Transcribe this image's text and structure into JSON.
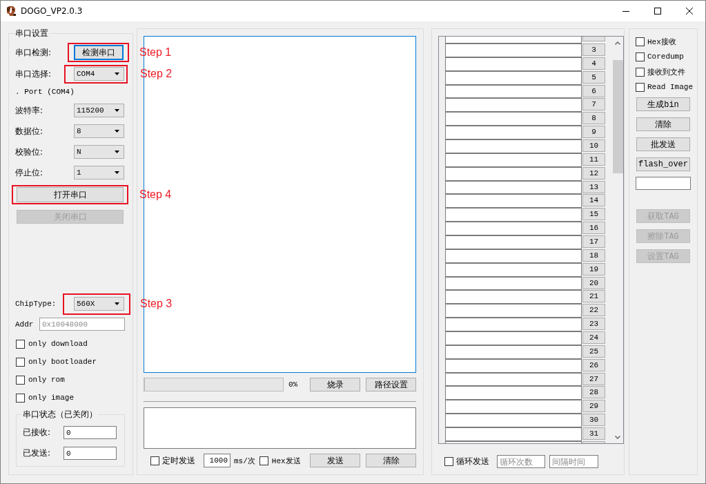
{
  "window": {
    "title": "DOGO_VP2.0.3"
  },
  "serial_settings": {
    "title": "串口设置",
    "fields": [
      {
        "kind": "button",
        "label": "串口检测:",
        "value": "检测串口",
        "focused": true,
        "annotation": "Step 1"
      },
      {
        "kind": "select",
        "label": "串口选择:",
        "value": "COM4",
        "annotation": "Step 2"
      },
      {
        "kind": "text",
        "label": ". Port (COM4)"
      },
      {
        "kind": "select",
        "label": "波特率:",
        "value": "115200"
      },
      {
        "kind": "select",
        "label": "数据位:",
        "value": "8"
      },
      {
        "kind": "select",
        "label": "校验位:",
        "value": "N"
      },
      {
        "kind": "select",
        "label": "停止位:",
        "value": "1"
      }
    ],
    "open_button": {
      "label": "打开串口",
      "disabled": false,
      "annotation": "Step 4"
    },
    "close_button": {
      "label": "关闭串口",
      "disabled": true
    },
    "chip_type": {
      "label": "ChipType:",
      "value": "560X",
      "annotation": "Step 3"
    },
    "addr": {
      "label": "Addr",
      "placeholder": "0x10048000"
    },
    "options": [
      {
        "label": "only download",
        "checked": false
      },
      {
        "label": "only bootloader",
        "checked": false
      },
      {
        "label": "only rom",
        "checked": false
      },
      {
        "label": "only image",
        "checked": false
      }
    ],
    "port_status": {
      "title": "串口状态（已关闭）",
      "counters": [
        {
          "label": "已接收:",
          "value": "0"
        },
        {
          "label": "已发送:",
          "value": "0"
        }
      ]
    }
  },
  "data_panel": {
    "receive_area": {
      "focused": true
    },
    "progress": {
      "level": 0,
      "reading": "0%"
    },
    "flash_buttons": [
      "烧录",
      "路径设置"
    ],
    "timed_send": {
      "label": "定时发送",
      "checked": false
    },
    "interval": {
      "value": "1000",
      "unit": "ms/次"
    },
    "hex_send": {
      "label": "Hex发送",
      "checked": false
    },
    "send_buttons": [
      "发送",
      "清除"
    ]
  },
  "send_list": {
    "rows": [
      {
        "number": "3"
      },
      {
        "number": "4"
      },
      {
        "number": "5"
      },
      {
        "number": "6"
      },
      {
        "number": "7"
      },
      {
        "number": "8"
      },
      {
        "number": "9"
      },
      {
        "number": "10"
      },
      {
        "number": "11"
      },
      {
        "number": "12"
      },
      {
        "number": "13"
      },
      {
        "number": "14"
      },
      {
        "number": "15"
      },
      {
        "number": "16"
      },
      {
        "number": "17"
      },
      {
        "number": "18"
      },
      {
        "number": "19"
      },
      {
        "number": "20"
      },
      {
        "number": "21"
      },
      {
        "number": "22"
      },
      {
        "number": "23"
      },
      {
        "number": "24"
      },
      {
        "number": "25"
      },
      {
        "number": "26"
      },
      {
        "number": "27"
      },
      {
        "number": "28"
      },
      {
        "number": "29"
      },
      {
        "number": "30"
      },
      {
        "number": "31"
      }
    ],
    "loop_send": {
      "label": "循环发送",
      "checked": false
    },
    "loop_count": {
      "placeholder": "循环次数"
    },
    "loop_interval": {
      "placeholder": "间隔时间"
    }
  },
  "receive_options": {
    "checkboxes": [
      {
        "label": "Hex接收",
        "checked": false
      },
      {
        "label": "Coredump",
        "checked": false
      },
      {
        "label": "接收到文件",
        "checked": false
      },
      {
        "label": "Read Image",
        "checked": false
      }
    ],
    "buttons": [
      {
        "label": "生成bin",
        "disabled": false
      },
      {
        "label": "清除",
        "disabled": false
      },
      {
        "label": "批发送",
        "disabled": false
      },
      {
        "label": "flash_over",
        "disabled": false
      }
    ],
    "tag_buttons": [
      {
        "label": "获取TAG",
        "disabled": true
      },
      {
        "label": "擦除TAG",
        "disabled": true
      },
      {
        "label": "设置TAG",
        "disabled": true
      }
    ]
  }
}
